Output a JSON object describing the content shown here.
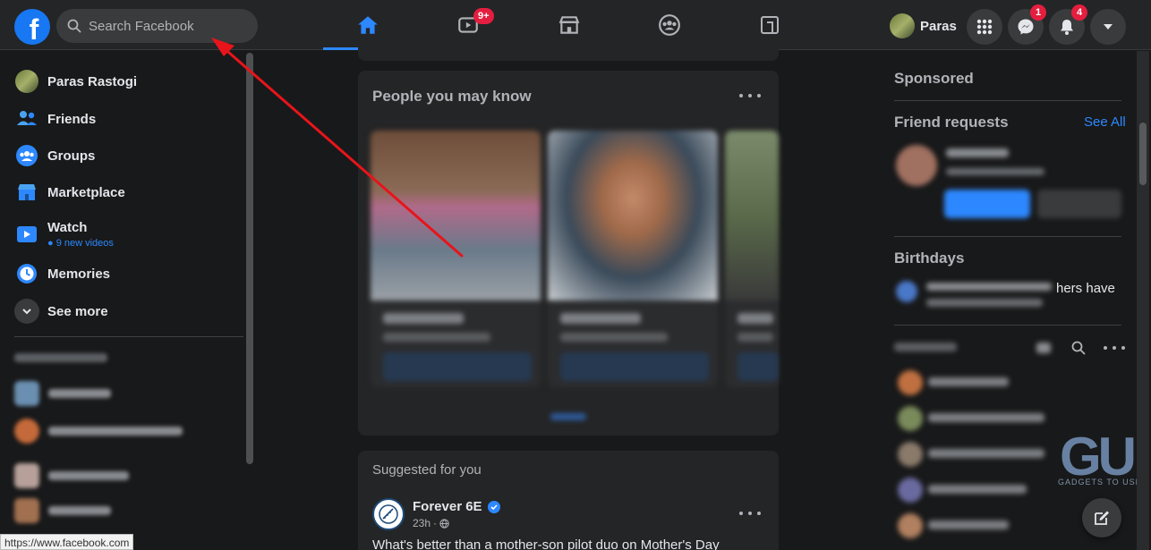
{
  "topbar": {
    "search_placeholder": "Search Facebook",
    "watch_badge": "9+",
    "profile_name": "Paras",
    "messenger_badge": "1",
    "notifications_badge": "4"
  },
  "sidebar": {
    "items": [
      {
        "label": "Paras Rastogi"
      },
      {
        "label": "Friends"
      },
      {
        "label": "Groups"
      },
      {
        "label": "Marketplace"
      },
      {
        "label": "Watch",
        "sub": "9 new videos"
      },
      {
        "label": "Memories"
      },
      {
        "label": "See more"
      }
    ]
  },
  "feed": {
    "pymk_title": "People you may know",
    "suggested_label": "Suggested for you",
    "post": {
      "author": "Forever 6E",
      "time": "23h",
      "text": "What's better than a mother-son pilot duo on Mother's Day"
    }
  },
  "right": {
    "sponsored": "Sponsored",
    "friend_requests": "Friend requests",
    "see_all": "See All",
    "birthdays": "Birthdays",
    "birthday_visible": "hers have"
  },
  "status_bar_url": "https://www.facebook.com",
  "watermark": {
    "text": "GADGETS TO USE"
  },
  "colors": {
    "accent": "#2d88ff",
    "brand": "#1877f2",
    "badge": "#e41e3f",
    "arrow": "#e8141b"
  }
}
